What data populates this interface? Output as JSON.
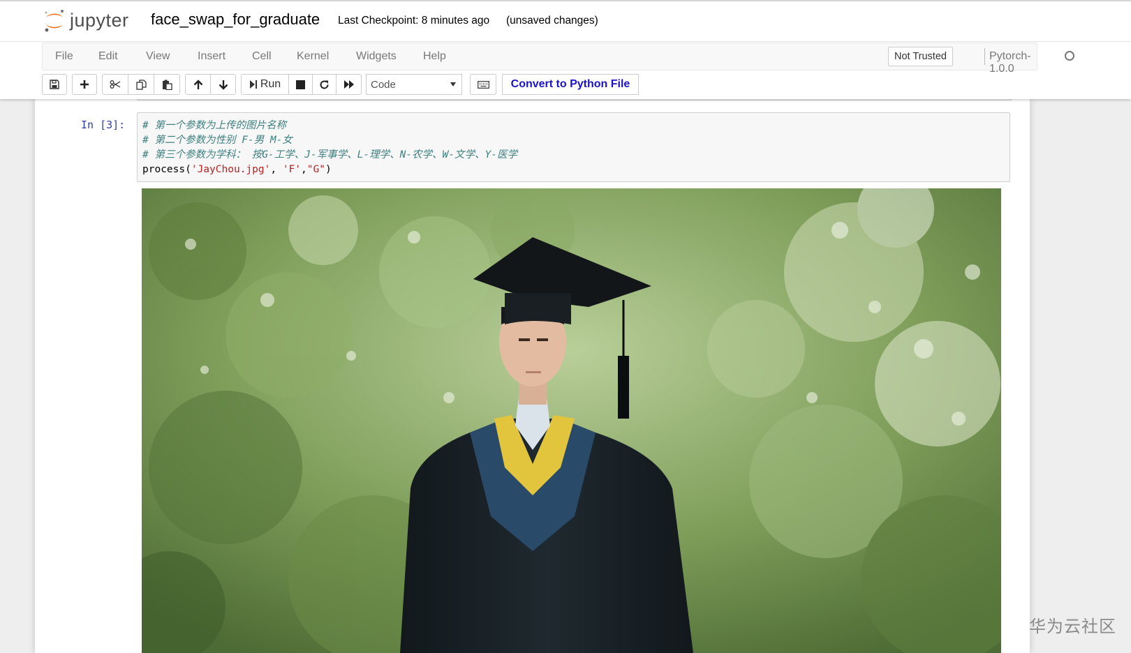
{
  "header": {
    "logo_text": "jupyter",
    "notebook_name": "face_swap_for_graduate",
    "checkpoint": "Last Checkpoint: 8 minutes ago",
    "unsaved": "(unsaved changes)"
  },
  "menu": {
    "items": [
      "File",
      "Edit",
      "View",
      "Insert",
      "Cell",
      "Kernel",
      "Widgets",
      "Help"
    ],
    "trusted": "Not Trusted",
    "kernel": "Pytorch-1.0.0"
  },
  "toolbar": {
    "run_label": "Run",
    "cell_type": "Code",
    "convert_label": "Convert to Python File",
    "icons": [
      "save-icon",
      "plus-icon",
      "cut-icon",
      "copy-icon",
      "paste-icon",
      "arrow-up-icon",
      "arrow-down-icon",
      "run-icon",
      "stop-icon",
      "restart-icon",
      "fast-forward-icon",
      "keyboard-icon"
    ]
  },
  "cell": {
    "prompt": "In  [3]:",
    "comment1": "# 第一个参数为上传的图片名称",
    "comment2": "# 第二个参数为性别 F-男 M-女",
    "comment3": "# 第三个参数为学科： 按G-工学、J-军事学、L-理学、N-农学、W-文学、Y-医学",
    "code_fn": "process(",
    "code_arg1": "'JayChou.jpg'",
    "code_sep1": ", ",
    "code_arg2": "'F'",
    "code_sep2": ",",
    "code_arg3": "\"G\"",
    "code_end": ")"
  },
  "output": {
    "image_subject": "graduate-portrait"
  },
  "watermark": "华为云社区",
  "colors": {
    "prompt": "#303f9f",
    "comment": "#408080",
    "string": "#ba2121",
    "convert_text": "#1a13c8",
    "logo_orange": "#f37626"
  }
}
